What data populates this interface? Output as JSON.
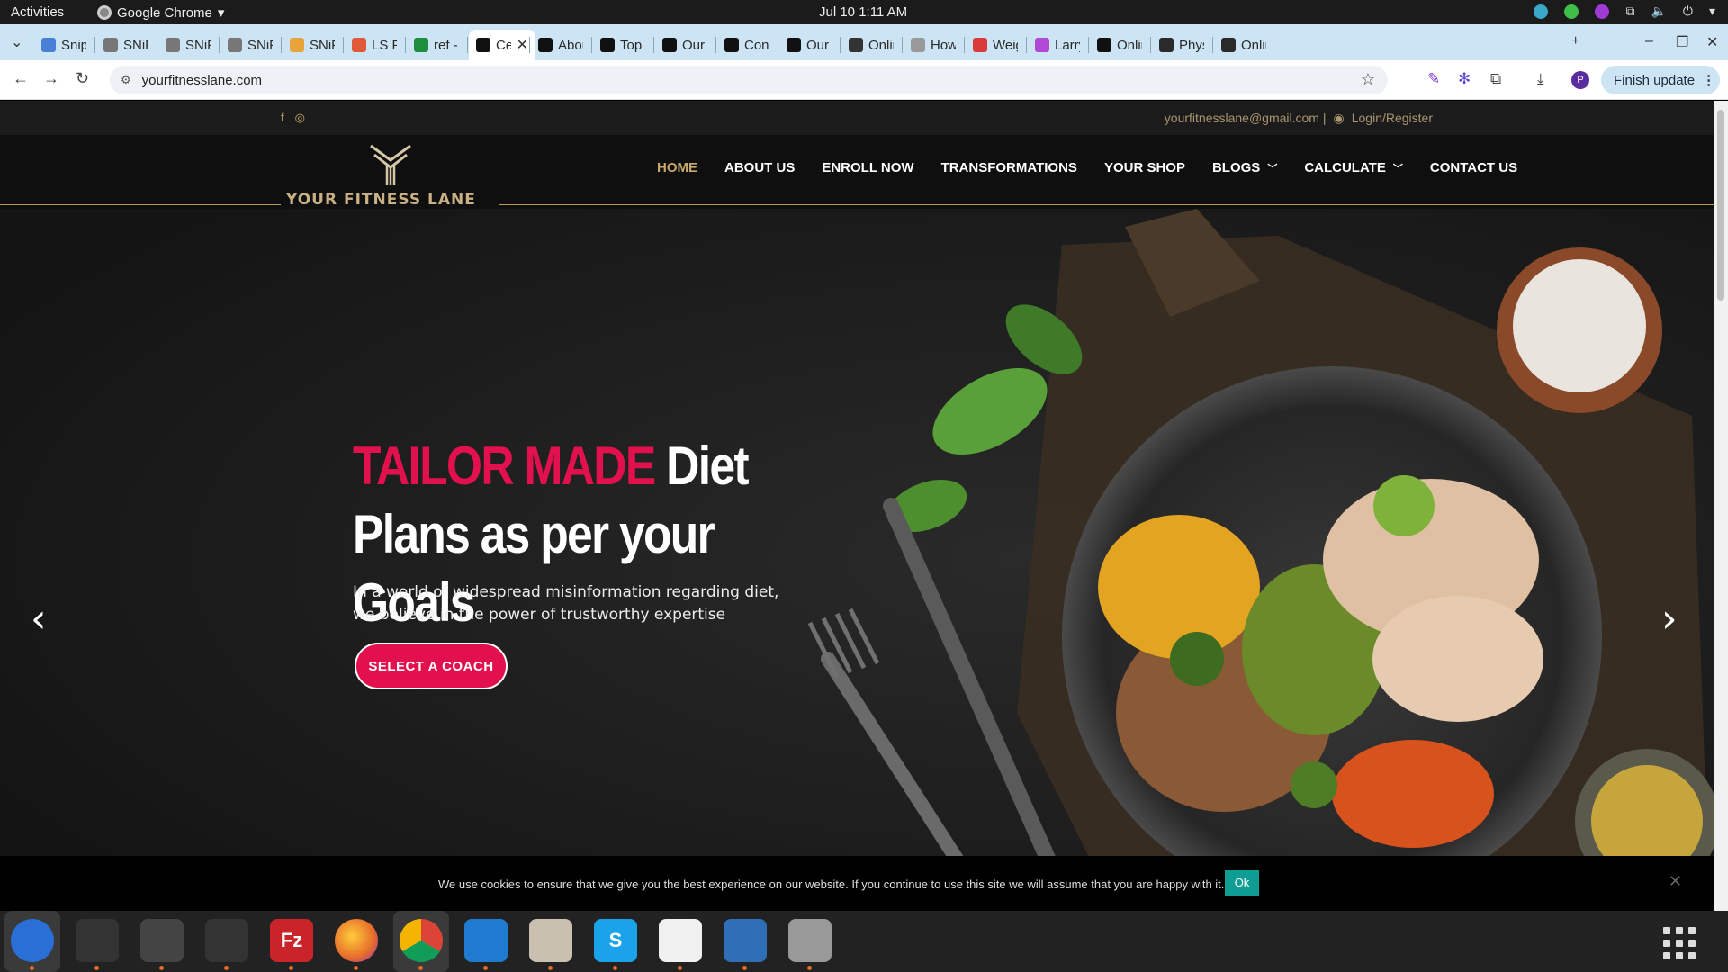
{
  "system": {
    "activities": "Activities",
    "app_name": "Google Chrome",
    "clock": "Jul 10  1:11 AM"
  },
  "tabs": [
    {
      "title": "Snip",
      "favicon_color": "#4a7fd6"
    },
    {
      "title": "SNiP",
      "favicon_color": "#777777"
    },
    {
      "title": "SNiP",
      "favicon_color": "#777777"
    },
    {
      "title": "SNiP",
      "favicon_color": "#777777"
    },
    {
      "title": "SNiP",
      "favicon_color": "#e8a33a"
    },
    {
      "title": "LS Pr",
      "favicon_color": "#e05a3a"
    },
    {
      "title": "ref - C",
      "favicon_color": "#1e8e3e"
    },
    {
      "title": "Ce",
      "favicon_color": "#111111",
      "active": true
    },
    {
      "title": "Abou",
      "favicon_color": "#111111"
    },
    {
      "title": "Top C",
      "favicon_color": "#111111"
    },
    {
      "title": "Our T",
      "favicon_color": "#111111"
    },
    {
      "title": "Conta",
      "favicon_color": "#111111"
    },
    {
      "title": "Our T",
      "favicon_color": "#111111"
    },
    {
      "title": "Onlin",
      "favicon_color": "#333333"
    },
    {
      "title": "How I",
      "favicon_color": "#999999"
    },
    {
      "title": "Weigl",
      "favicon_color": "#d93a3a"
    },
    {
      "title": "Larry",
      "favicon_color": "#b04ad6"
    },
    {
      "title": "Onlin",
      "favicon_color": "#111111"
    },
    {
      "title": "Physi",
      "favicon_color": "#2a2a2a"
    },
    {
      "title": "Onlin",
      "favicon_color": "#2a2a2a"
    }
  ],
  "browser": {
    "url": "yourfitnesslane.com",
    "finish_update": "Finish update",
    "profile_initial": "P"
  },
  "site": {
    "email": "yourfitnesslane@gmail.com |",
    "login": "Login/Register",
    "logo_text": "YOUR FITNESS LANE",
    "menu": [
      {
        "label": "HOME",
        "current": true
      },
      {
        "label": "ABOUT US"
      },
      {
        "label": "ENROLL NOW"
      },
      {
        "label": "TRANSFORMATIONS"
      },
      {
        "label": "YOUR SHOP"
      },
      {
        "label": "BLOGS",
        "dropdown": true
      },
      {
        "label": "CALCULATE",
        "dropdown": true
      },
      {
        "label": "CONTACT US"
      }
    ],
    "hero": {
      "title_accent": "TAILOR MADE",
      "title_rest": "Diet Plans as per your Goals",
      "subtitle_line1": "In a world of widespread misinformation regarding diet,",
      "subtitle_line2": "we believe in the power of trustworthy expertise",
      "cta": "SELECT A COACH"
    },
    "cookie": {
      "message": "We use cookies to ensure that we give you the best experience on our website. If you continue to use this site we will assume that you are happy with it.",
      "ok": "Ok"
    }
  },
  "colors": {
    "accent": "#e2114e",
    "gold": "#c9a96a",
    "tab_strip": "#cde4f4"
  },
  "dock": [
    {
      "name": "thunderbird",
      "color": "#2a6fd6"
    },
    {
      "name": "terminal",
      "color": "#333333"
    },
    {
      "name": "calculator",
      "color": "#444444"
    },
    {
      "name": "system-monitor",
      "color": "#333333"
    },
    {
      "name": "filezilla",
      "color": "#c8242a",
      "glyph": "Fz"
    },
    {
      "name": "firefox",
      "color": "#e66b2a"
    },
    {
      "name": "chrome",
      "color": "#ffffff"
    },
    {
      "name": "vscode",
      "color": "#1e7bd0"
    },
    {
      "name": "files",
      "color": "#c9c0b0"
    },
    {
      "name": "skype",
      "color": "#1aa3e8",
      "glyph": "S"
    },
    {
      "name": "text-editor",
      "color": "#f0f0f0"
    },
    {
      "name": "writer",
      "color": "#2f6fb8"
    },
    {
      "name": "disk-utility",
      "color": "#999999"
    }
  ]
}
